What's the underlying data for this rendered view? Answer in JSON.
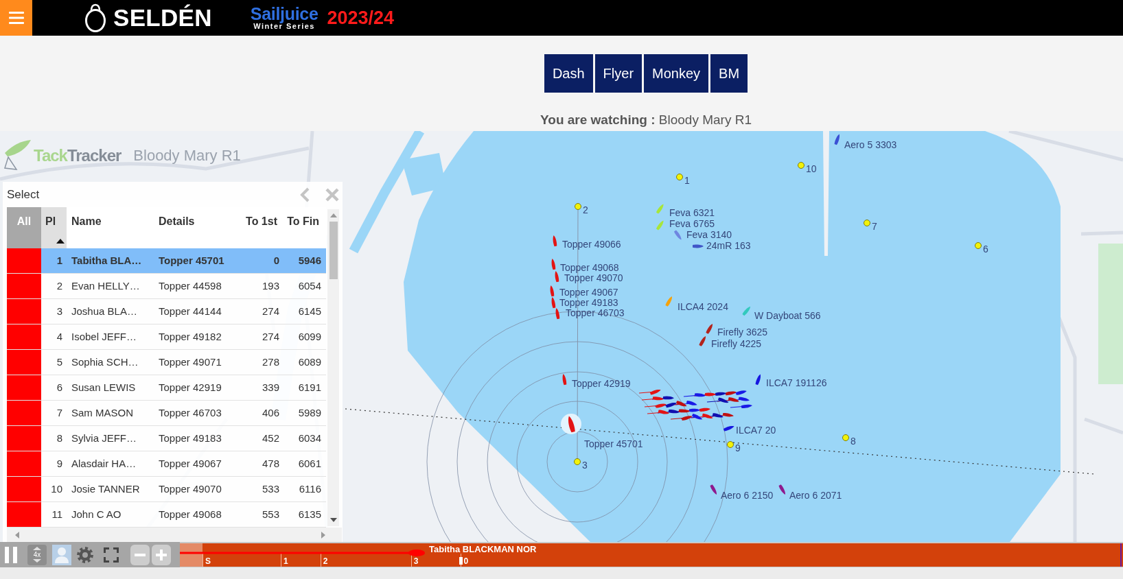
{
  "header": {
    "brand": "SELDÉN",
    "series_title": "Sailjuice",
    "series_subtitle": "Winter Series",
    "season": "2023/24"
  },
  "class_buttons": [
    "Dash",
    "Flyer",
    "Monkey",
    "BM"
  ],
  "watching": "**You are watching :** Bloody Mary R1",
  "map": {
    "logo_parts": [
      "Tack",
      "Tracker"
    ],
    "race_title": "Bloody Mary R1",
    "marks": [
      "1",
      "10",
      "2",
      "7",
      "6",
      "9",
      "8",
      "3"
    ],
    "boats": [
      {
        "label": "Aero 5 3303",
        "color": "#3b50d4",
        "selected": false
      },
      {
        "label": "Feva 6321",
        "color": "#a8e63a",
        "selected": false
      },
      {
        "label": "Feva 6765",
        "color": "#a8e63a",
        "selected": false
      },
      {
        "label": "Feva 3140",
        "color": "#6f86e0",
        "selected": false
      },
      {
        "label": "24mR 163",
        "color": "#4056c8",
        "selected": false
      },
      {
        "label": "Topper 49066",
        "color": "#e31414",
        "selected": false
      },
      {
        "label": "Topper 49068",
        "color": "#e31414",
        "selected": false
      },
      {
        "label": "Topper 49070",
        "color": "#e31414",
        "selected": false
      },
      {
        "label": "Topper 49067",
        "color": "#e31414",
        "selected": false
      },
      {
        "label": "Topper 49183",
        "color": "#e31414",
        "selected": false
      },
      {
        "label": "Topper 46703",
        "color": "#e31414",
        "selected": false
      },
      {
        "label": "ILCA4 2024",
        "color": "#f5a20a",
        "selected": false
      },
      {
        "label": "W Dayboat 566",
        "color": "#33c9bd",
        "selected": false
      },
      {
        "label": "Firefly 3625",
        "color": "#b3231c",
        "selected": false
      },
      {
        "label": "Firefly 4225",
        "color": "#b3231c",
        "selected": false
      },
      {
        "label": "Topper 42919",
        "color": "#e31414",
        "selected": false
      },
      {
        "label": "ILCA7 191126",
        "color": "#1717e0",
        "selected": false
      },
      {
        "label": "ILCA7 20",
        "color": "#1717e0",
        "selected": false
      },
      {
        "label": "Topper 45701",
        "color": "#e31414",
        "selected": true
      },
      {
        "label": "Aero 6 2150",
        "color": "#8e1a8e",
        "selected": false
      },
      {
        "label": "Aero 6 2071",
        "color": "#8e1a8e",
        "selected": false
      }
    ]
  },
  "leaderboard": {
    "title": "Select",
    "select_all": "All",
    "columns": [
      {
        "label": "Pl",
        "kind": "rank",
        "sorted": true
      },
      {
        "label": "Name",
        "kind": "text",
        "sorted": false
      },
      {
        "label": "Details",
        "kind": "text",
        "sorted": false
      },
      {
        "label": "To 1st",
        "kind": "number",
        "sorted": false
      },
      {
        "label": "To Fin",
        "kind": "number",
        "sorted": false
      }
    ],
    "rows": [
      {
        "selected": true,
        "color": "#ff0000",
        "cells": [
          "1",
          "Tabitha BLA…",
          "Topper 45701",
          "0",
          "5946"
        ]
      },
      {
        "selected": false,
        "color": "#ff0000",
        "cells": [
          "2",
          "Evan HELLY…",
          "Topper 44598",
          "193",
          "6054"
        ]
      },
      {
        "selected": false,
        "color": "#ff0000",
        "cells": [
          "3",
          "Joshua BLA…",
          "Topper 44144",
          "274",
          "6145"
        ]
      },
      {
        "selected": false,
        "color": "#ff0000",
        "cells": [
          "4",
          "Isobel JEFF…",
          "Topper 49182",
          "274",
          "6099"
        ]
      },
      {
        "selected": false,
        "color": "#ff0000",
        "cells": [
          "5",
          "Sophia SCH…",
          "Topper 49071",
          "278",
          "6089"
        ]
      },
      {
        "selected": false,
        "color": "#ff0000",
        "cells": [
          "6",
          "Susan LEWIS",
          "Topper 42919",
          "339",
          "6191"
        ]
      },
      {
        "selected": false,
        "color": "#ff0000",
        "cells": [
          "7",
          "Sam MASON",
          "Topper 46703",
          "406",
          "5989"
        ]
      },
      {
        "selected": false,
        "color": "#ff0000",
        "cells": [
          "8",
          "Sylvia JEFF…",
          "Topper 49183",
          "452",
          "6034"
        ]
      },
      {
        "selected": false,
        "color": "#ff0000",
        "cells": [
          "9",
          "Alasdair HA…",
          "Topper 49067",
          "478",
          "6061"
        ]
      },
      {
        "selected": false,
        "color": "#ff0000",
        "cells": [
          "10",
          "Josie TANNER",
          "Topper 49070",
          "533",
          "6116"
        ]
      },
      {
        "selected": false,
        "color": "#ff0000",
        "cells": [
          "11",
          "John C AO",
          "Topper 49068",
          "553",
          "6135"
        ]
      }
    ]
  },
  "playback": {
    "controls": [
      {
        "kind": "pause",
        "on": false
      },
      {
        "kind": "speed",
        "label": "4x",
        "on": false
      },
      {
        "kind": "follow",
        "on": true
      },
      {
        "kind": "settings",
        "on": false
      },
      {
        "kind": "fullscreen",
        "on": false
      },
      {
        "kind": "zoom_out",
        "on": false
      },
      {
        "kind": "zoom_in",
        "on": false
      }
    ],
    "timeline": {
      "level": 0.296,
      "ticks": [
        "S",
        "1",
        "2",
        "3",
        "0"
      ],
      "boat_label": "Tabitha BLACKMAN NOR"
    }
  }
}
